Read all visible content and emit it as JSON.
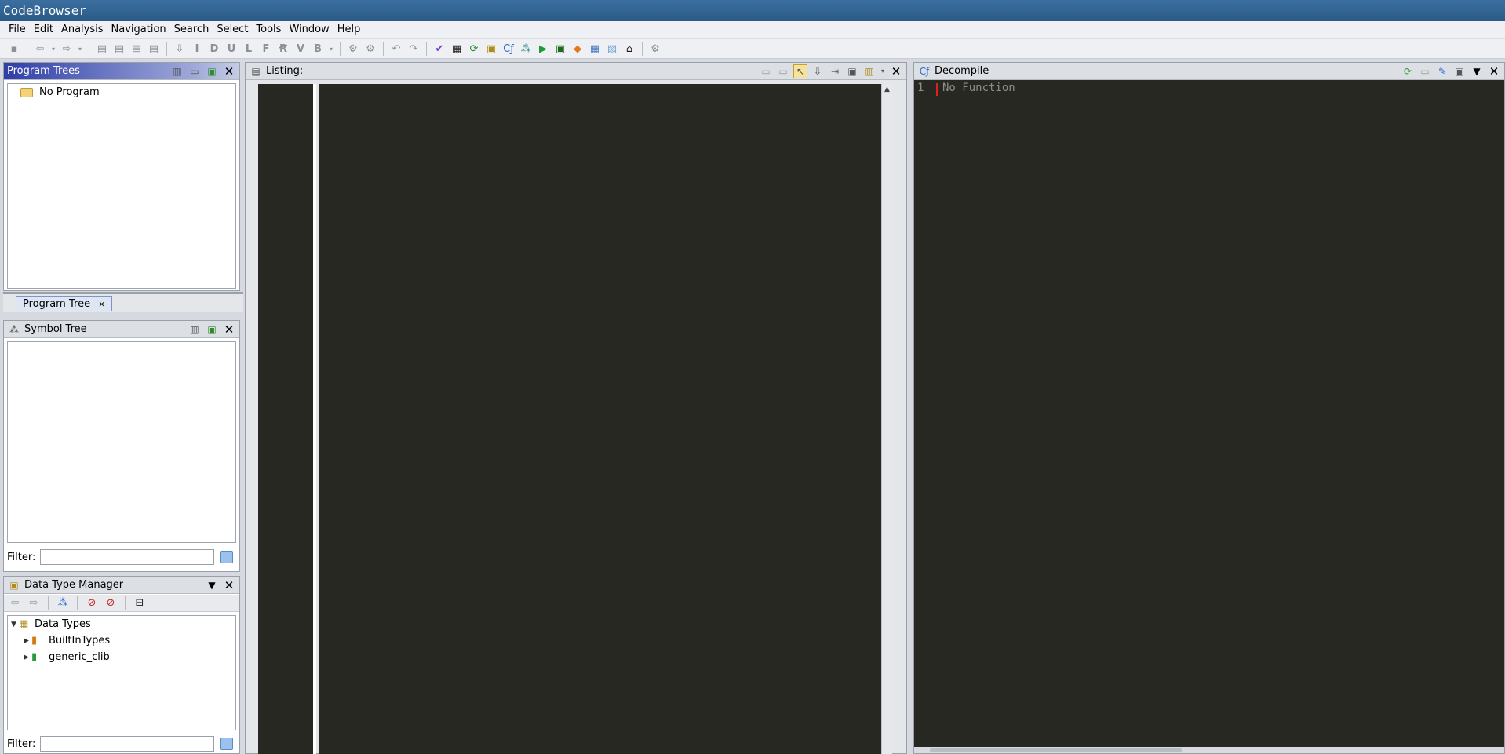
{
  "window": {
    "title": "CodeBrowser"
  },
  "menu": {
    "items": [
      {
        "label": "File"
      },
      {
        "label": "Edit"
      },
      {
        "label": "Analysis"
      },
      {
        "label": "Navigation"
      },
      {
        "label": "Search"
      },
      {
        "label": "Select"
      },
      {
        "label": "Tools"
      },
      {
        "label": "Window"
      },
      {
        "label": "Help"
      }
    ]
  },
  "program_trees": {
    "title": "Program Trees",
    "root_label": "No Program",
    "tab_label": "Program Tree",
    "tab_close": "×"
  },
  "symbol_tree": {
    "title": "Symbol Tree",
    "filter_label": "Filter:",
    "filter_value": ""
  },
  "data_type_manager": {
    "title": "Data Type Manager",
    "root_label": "Data Types",
    "children": [
      {
        "label": "BuiltInTypes"
      },
      {
        "label": "generic_clib"
      }
    ],
    "filter_label": "Filter:",
    "filter_value": ""
  },
  "listing": {
    "title": "Listing:"
  },
  "decompile": {
    "title": "Decompile",
    "line_number": "1",
    "line_text": "No Function"
  },
  "colors": {
    "code_bg": "#272822",
    "active_header": "#2f3ea8",
    "cursor": "#e02020"
  }
}
